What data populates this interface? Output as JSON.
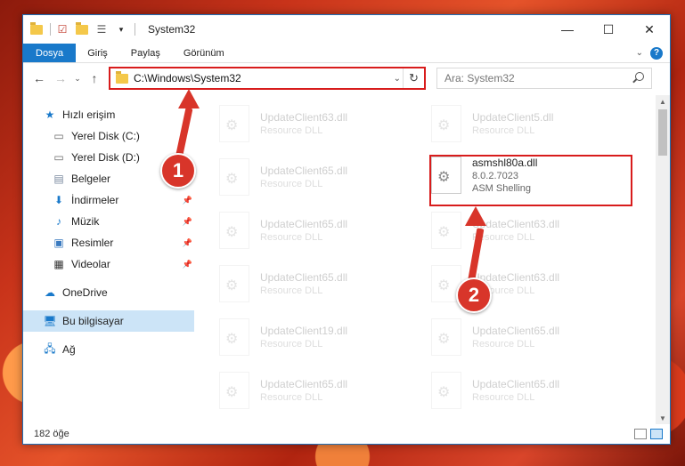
{
  "window": {
    "title": "System32",
    "controls": {
      "minimize": "—",
      "maximize": "☐",
      "close": "✕"
    }
  },
  "ribbon": {
    "tabs": [
      "Dosya",
      "Giriş",
      "Paylaş",
      "Görünüm"
    ],
    "active_tab": "Dosya",
    "help": "?"
  },
  "navigation": {
    "address": "C:\\Windows\\System32",
    "search_placeholder": "Ara: System32"
  },
  "sidebar": {
    "quick_access": "Hızlı erişim",
    "items": [
      {
        "label": "Yerel Disk (C:)",
        "icon": "drive-icon",
        "pinned": false
      },
      {
        "label": "Yerel Disk (D:)",
        "icon": "drive-icon",
        "pinned": false
      },
      {
        "label": "Belgeler",
        "icon": "documents-icon",
        "pinned": true
      },
      {
        "label": "İndirmeler",
        "icon": "downloads-icon",
        "pinned": true
      },
      {
        "label": "Müzik",
        "icon": "music-icon",
        "pinned": true
      },
      {
        "label": "Resimler",
        "icon": "pictures-icon",
        "pinned": true
      },
      {
        "label": "Videolar",
        "icon": "videos-icon",
        "pinned": true
      }
    ],
    "onedrive": "OneDrive",
    "this_pc": "Bu bilgisayar",
    "network": "Ağ"
  },
  "files": {
    "left_column": [
      {
        "name": "UpdateClient63.dll",
        "type": "Resource DLL"
      },
      {
        "name": "UpdateClient65.dll",
        "type": "Resource DLL"
      },
      {
        "name": "UpdateClient65.dll",
        "type": "Resource DLL"
      },
      {
        "name": "UpdateClient65.dll",
        "type": "Resource DLL"
      },
      {
        "name": "UpdateClient19.dll",
        "type": "Resource DLL"
      },
      {
        "name": "UpdateClient65.dll",
        "type": "Resource DLL"
      }
    ],
    "right_column": [
      {
        "name": "UpdateClient5.dll",
        "type": "Resource DLL"
      },
      {
        "name": "UpdateClient63.dll",
        "type": "Resource DLL"
      },
      {
        "name": "UpdateClient63.dll",
        "type": "Resource DLL"
      },
      {
        "name": "UpdateClient65.dll",
        "type": "Resource DLL"
      },
      {
        "name": "UpdateClient65.dll",
        "type": "Resource DLL"
      }
    ],
    "highlighted": {
      "name": "asmshl80a.dll",
      "version": "8.0.2.7023",
      "description": "ASM Shelling"
    }
  },
  "status": {
    "item_count": "182 öğe"
  },
  "annotations": {
    "step1": "1",
    "step2": "2",
    "color": "#d8352a"
  }
}
